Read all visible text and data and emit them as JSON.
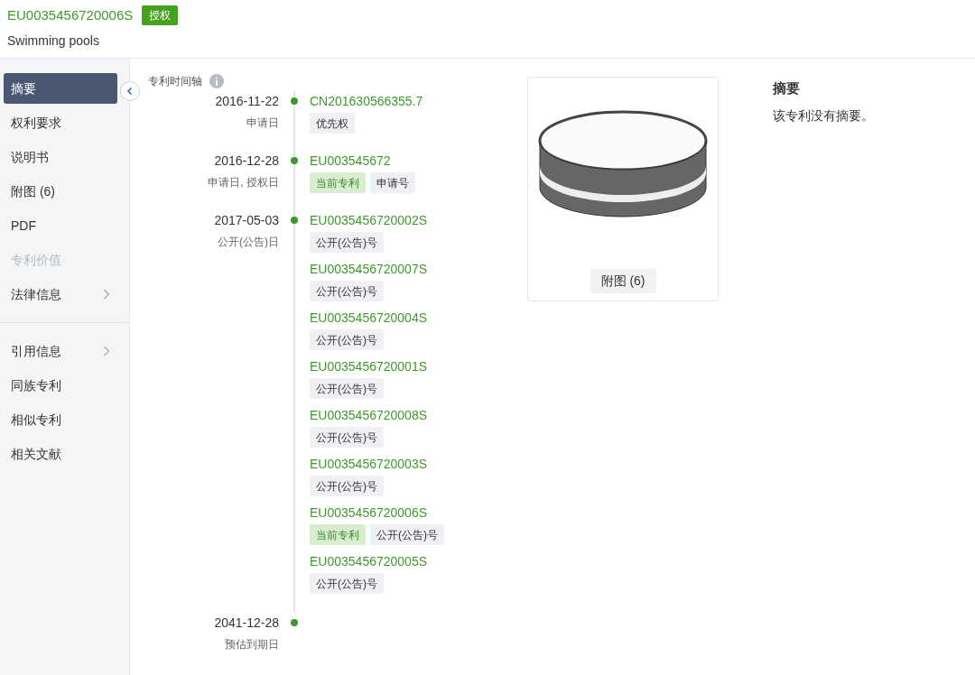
{
  "header": {
    "number": "EU0035456720006S",
    "status": "授权",
    "title": "Swimming pools"
  },
  "sidebar": {
    "groups": [
      [
        {
          "label": "摘要",
          "selected": true,
          "disabled": false,
          "has_submenu": false
        },
        {
          "label": "权利要求",
          "selected": false,
          "disabled": false,
          "has_submenu": false
        },
        {
          "label": "说明书",
          "selected": false,
          "disabled": false,
          "has_submenu": false
        },
        {
          "label": "附图 (6)",
          "selected": false,
          "disabled": false,
          "has_submenu": false
        },
        {
          "label": "PDF",
          "selected": false,
          "disabled": false,
          "has_submenu": false
        },
        {
          "label": "专利价值",
          "selected": false,
          "disabled": true,
          "has_submenu": false
        },
        {
          "label": "法律信息",
          "selected": false,
          "disabled": false,
          "has_submenu": true
        }
      ],
      [
        {
          "label": "引用信息",
          "selected": false,
          "disabled": false,
          "has_submenu": true
        },
        {
          "label": "同族专利",
          "selected": false,
          "disabled": false,
          "has_submenu": false
        },
        {
          "label": "相似专利",
          "selected": false,
          "disabled": false,
          "has_submenu": false
        },
        {
          "label": "相关文献",
          "selected": false,
          "disabled": false,
          "has_submenu": false
        }
      ]
    ]
  },
  "timeline": {
    "title": "专利时间轴",
    "events": [
      {
        "date": "2016-11-22",
        "label": "申请日",
        "docs": [
          {
            "number": "CN201630566355.7",
            "tags": [
              {
                "kind": "plain",
                "text": "优先权"
              }
            ]
          }
        ]
      },
      {
        "date": "2016-12-28",
        "label": "申请日, 授权日",
        "docs": [
          {
            "number": "EU003545672",
            "tags": [
              {
                "kind": "current",
                "text": "当前专利"
              },
              {
                "kind": "plain",
                "text": "申请号"
              }
            ]
          }
        ]
      },
      {
        "date": "2017-05-03",
        "label": "公开(公告)日",
        "docs": [
          {
            "number": "EU0035456720002S",
            "tags": [
              {
                "kind": "plain",
                "text": "公开(公告)号"
              }
            ]
          },
          {
            "number": "EU0035456720007S",
            "tags": [
              {
                "kind": "plain",
                "text": "公开(公告)号"
              }
            ]
          },
          {
            "number": "EU0035456720004S",
            "tags": [
              {
                "kind": "plain",
                "text": "公开(公告)号"
              }
            ]
          },
          {
            "number": "EU0035456720001S",
            "tags": [
              {
                "kind": "plain",
                "text": "公开(公告)号"
              }
            ]
          },
          {
            "number": "EU0035456720008S",
            "tags": [
              {
                "kind": "plain",
                "text": "公开(公告)号"
              }
            ]
          },
          {
            "number": "EU0035456720003S",
            "tags": [
              {
                "kind": "plain",
                "text": "公开(公告)号"
              }
            ]
          },
          {
            "number": "EU0035456720006S",
            "tags": [
              {
                "kind": "current",
                "text": "当前专利"
              },
              {
                "kind": "plain",
                "text": "公开(公告)号"
              }
            ]
          },
          {
            "number": "EU0035456720005S",
            "tags": [
              {
                "kind": "plain",
                "text": "公开(公告)号"
              }
            ]
          }
        ]
      },
      {
        "date": "2041-12-28",
        "label": "预估到期日"
      }
    ]
  },
  "figure": {
    "caption": "附图 (6)"
  },
  "abstract": {
    "heading": "摘要",
    "text": "该专利没有摘要。"
  }
}
